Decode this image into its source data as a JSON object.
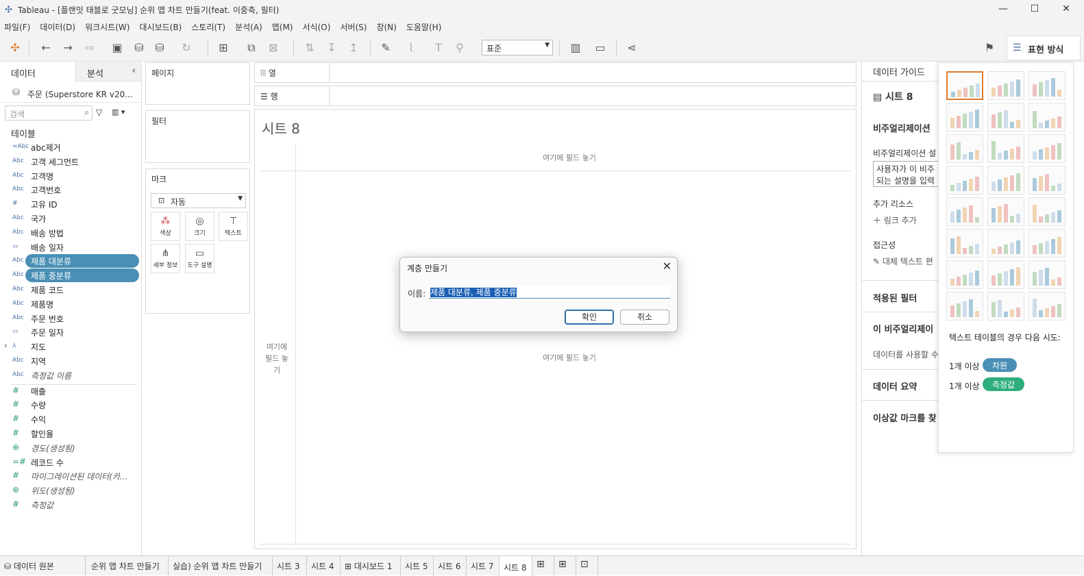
{
  "window": {
    "title": "Tableau - [플랜잇 태블로 굿모닝] 순위 맵 차트 만들기(feat. 이중축, 필터)",
    "minimize": "—",
    "maximize": "☐",
    "close": "✕"
  },
  "menu": [
    "파일(F)",
    "데이터(D)",
    "워크시트(W)",
    "대시보드(B)",
    "스토리(T)",
    "분석(A)",
    "맵(M)",
    "서식(O)",
    "서버(S)",
    "창(N)",
    "도움말(H)"
  ],
  "toolbar": {
    "fit_select": "표준",
    "show_me": "표현 방식"
  },
  "data_pane": {
    "tab_data": "데이터",
    "tab_analysis": "분석",
    "datasource": "주문 (Superstore KR v20...",
    "search_placeholder": "검색",
    "tables_header": "테이블",
    "fields": [
      {
        "type": "=Abc",
        "name": "abc제거",
        "kind": "dim"
      },
      {
        "type": "Abc",
        "name": "고객 세그먼트",
        "kind": "dim"
      },
      {
        "type": "Abc",
        "name": "고객명",
        "kind": "dim"
      },
      {
        "type": "Abc",
        "name": "고객번호",
        "kind": "dim"
      },
      {
        "type": "#",
        "name": "고유 ID",
        "kind": "dim"
      },
      {
        "type": "Abc",
        "name": "국가",
        "kind": "dim"
      },
      {
        "type": "Abc",
        "name": "배송 방법",
        "kind": "dim"
      },
      {
        "type": "▭",
        "name": "배송 일자",
        "kind": "dim"
      },
      {
        "type": "Abc",
        "name": "제품 대분류",
        "kind": "dim",
        "selected": true
      },
      {
        "type": "Abc",
        "name": "제품 중분류",
        "kind": "dim",
        "selected": true
      },
      {
        "type": "Abc",
        "name": "제품 코드",
        "kind": "dim"
      },
      {
        "type": "Abc",
        "name": "제품명",
        "kind": "dim"
      },
      {
        "type": "Abc",
        "name": "주문 번호",
        "kind": "dim"
      },
      {
        "type": "▭",
        "name": "주문 일자",
        "kind": "dim"
      },
      {
        "type": "⅄",
        "name": "지도",
        "kind": "dim",
        "expand": true
      },
      {
        "type": "Abc",
        "name": "지역",
        "kind": "dim"
      },
      {
        "type": "Abc",
        "name": "측정값 이름",
        "kind": "dim",
        "italic": true
      },
      {
        "type": "#",
        "name": "매출",
        "kind": "mea"
      },
      {
        "type": "#",
        "name": "수량",
        "kind": "mea"
      },
      {
        "type": "#",
        "name": "수익",
        "kind": "mea"
      },
      {
        "type": "#",
        "name": "할인율",
        "kind": "mea"
      },
      {
        "type": "⊕",
        "name": "경도(생성됨)",
        "kind": "mea",
        "italic": true
      },
      {
        "type": "=#",
        "name": "레코드 수",
        "kind": "mea"
      },
      {
        "type": "#",
        "name": "마이그레이션된 데이터(카...",
        "kind": "mea",
        "italic": true
      },
      {
        "type": "⊕",
        "name": "위도(생성됨)",
        "kind": "mea",
        "italic": true
      },
      {
        "type": "#",
        "name": "측정값",
        "kind": "mea",
        "italic": true
      }
    ]
  },
  "shelves": {
    "pages": "페이지",
    "filters": "필터",
    "marks": "마크",
    "marks_type": "자동",
    "columns": "열",
    "rows": "행",
    "mark_buttons": [
      {
        "label": "색상",
        "glyph": "⬤"
      },
      {
        "label": "크기",
        "glyph": "◎"
      },
      {
        "label": "텍스트",
        "glyph": "T"
      },
      {
        "label": "세부 정보",
        "glyph": "⋔"
      },
      {
        "label": "도구 설명",
        "glyph": "▭"
      }
    ]
  },
  "canvas": {
    "sheet_title": "시트 8",
    "drop_col": "여기에 필드 놓기",
    "drop_row": "여기에 필드 놓기",
    "drop_cell": "여기에 필드 놓기"
  },
  "guide": {
    "header": "데이터 가이드",
    "sheet": "시트 8",
    "viz_desc": "비주얼리제이션",
    "viz_label": "비주얼리제이션 설",
    "desc_text1": "사용자가 이 비주",
    "desc_text2": "되는 설명을 입력",
    "extra_res": "추가 리소스",
    "add_link": "링크 추가",
    "access": "접근성",
    "alt_text": "대체 텍스트 편",
    "applied_filters": "적용된 필터",
    "this_viz": "이 비주얼리제이",
    "using_data": "데이터를 사용할 수",
    "data_summary": "데이터 요약",
    "outlier": "이상값 마크를 찾"
  },
  "show_me": {
    "hint": "텍스트 테이블의 경우 다음 시도:",
    "req1": "1개 이상",
    "badge1": "차원",
    "req2": "1개 이상",
    "badge2": "측정값",
    "badge1_color": "#4a8fb5",
    "badge2_color": "#2eae7a"
  },
  "tabs": [
    "데이터 원본",
    "순위 맵 차트 만들기",
    "실습) 순위 맵 차트 만들기",
    "시트 3",
    "시트 4",
    "대시보드 1",
    "시트 5",
    "시트 6",
    "시트 7",
    "시트 8"
  ],
  "dialog": {
    "title": "계층 만들기",
    "name_label": "이름:",
    "name_value": "제품 대분류, 제품 중분류",
    "ok": "확인",
    "cancel": "취소"
  }
}
